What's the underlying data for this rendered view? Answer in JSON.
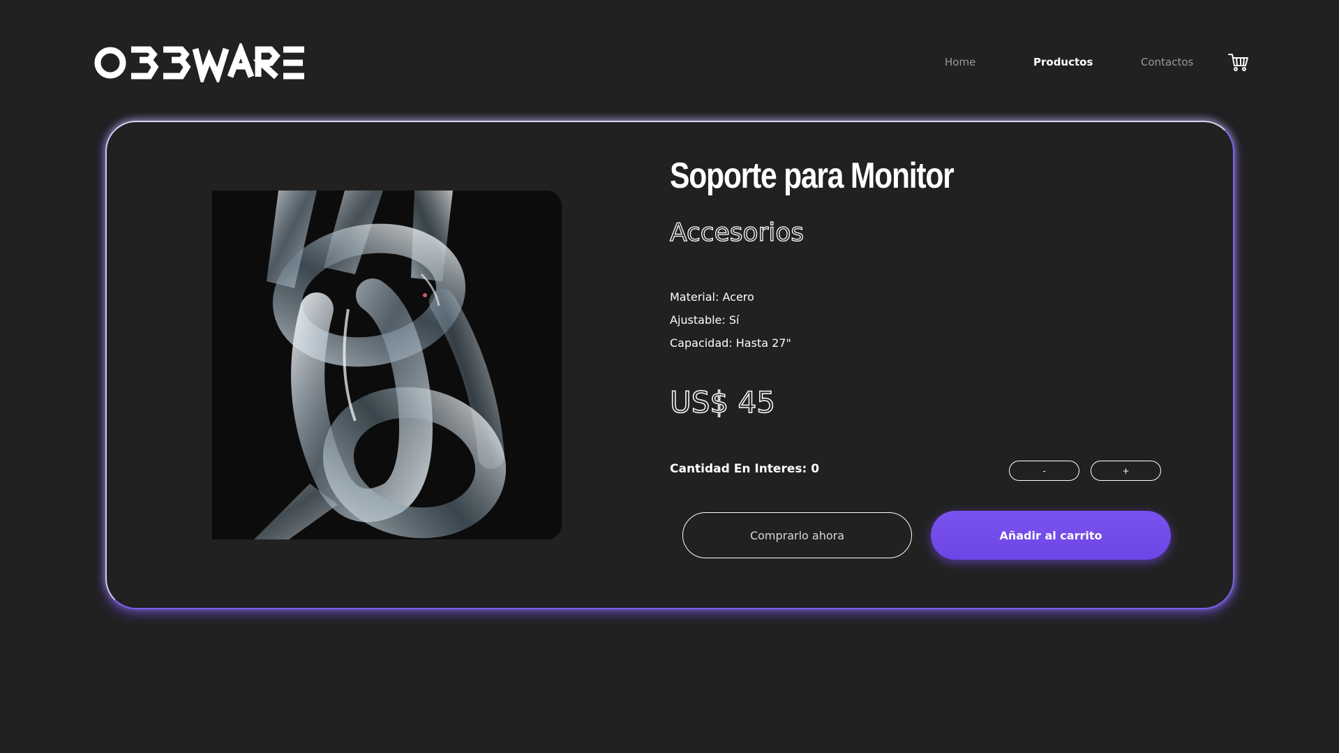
{
  "brand": {
    "logo_text": "OBBWARE"
  },
  "nav": {
    "items": [
      {
        "label": "Home",
        "active": false
      },
      {
        "label": "Productos",
        "active": true
      },
      {
        "label": "Contactos",
        "active": false
      }
    ],
    "cart_icon": "shopping-cart-icon"
  },
  "product": {
    "title": "Soporte para Monitor",
    "category": "Accesorios",
    "image_icon": "glass-chain-links-image",
    "specs": [
      "Material: Acero",
      "Ajustable: Sí",
      "Capacidad: Hasta 27\""
    ],
    "price": "US$ 45",
    "quantity_label": "Cantidad En Interes: 0",
    "decrement_label": "-",
    "increment_label": "+",
    "buy_now_label": "Comprarlo ahora",
    "add_to_cart_label": "Añadir al carrito"
  },
  "colors": {
    "background": "#212121",
    "accent": "#7350ec",
    "text": "#ffffff"
  }
}
